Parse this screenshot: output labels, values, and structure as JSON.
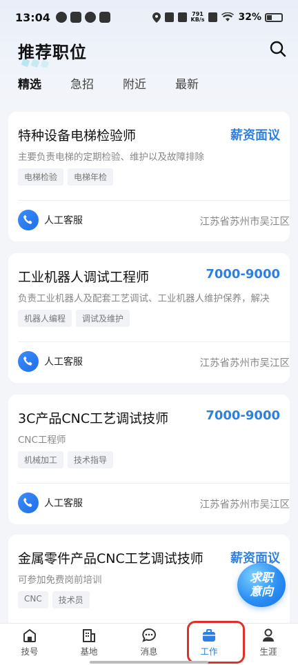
{
  "status_bar": {
    "time": "13:04",
    "speed_top": "791",
    "speed_bottom": "KB/s",
    "battery": "32%"
  },
  "header": {
    "title": "推荐职位",
    "search_icon": "search-icon"
  },
  "tabs": [
    {
      "label": "精选",
      "active": true
    },
    {
      "label": "急招",
      "active": false
    },
    {
      "label": "附近",
      "active": false
    },
    {
      "label": "最新",
      "active": false
    }
  ],
  "jobs": [
    {
      "title": "特种设备电梯检验师",
      "salary": "薪资面议",
      "desc": "主要负责电梯的定期检验、维护以及故障排除",
      "tags": [
        "电梯检验",
        "电梯年检"
      ],
      "service": "人工客服",
      "location": "江苏省苏州市吴江区"
    },
    {
      "title": "工业机器人调试工程师",
      "salary": "7000-9000",
      "desc": "负责工业机器人及配套工艺调试、工业机器人维护保养，解决",
      "tags": [
        "机器人编程",
        "调试及维护"
      ],
      "service": "人工客服",
      "location": "江苏省苏州市吴江区"
    },
    {
      "title": "3C产品CNC工艺调试技师",
      "salary": "7000-9000",
      "desc": "CNC工程师",
      "tags": [
        "机械加工",
        "技术指导"
      ],
      "service": "人工客服",
      "location": "江苏省苏州市吴江区"
    },
    {
      "title": "金属零件产品CNC工艺调试技师",
      "salary": "薪资面议",
      "desc": "可参加免费岗前培训",
      "tags": [
        "CNC",
        "技术员"
      ],
      "service": "",
      "location": ""
    }
  ],
  "fab": {
    "line1": "求职",
    "line2": "意向"
  },
  "bottom_nav": [
    {
      "label": "技号",
      "icon": "home-icon",
      "active": false
    },
    {
      "label": "基地",
      "icon": "building-icon",
      "active": false
    },
    {
      "label": "消息",
      "icon": "chat-icon",
      "active": false
    },
    {
      "label": "工作",
      "icon": "briefcase-icon",
      "active": true
    },
    {
      "label": "生涯",
      "icon": "person-icon",
      "active": false
    }
  ],
  "colors": {
    "accent": "#2f7fe0",
    "highlight": "#e0302c"
  }
}
